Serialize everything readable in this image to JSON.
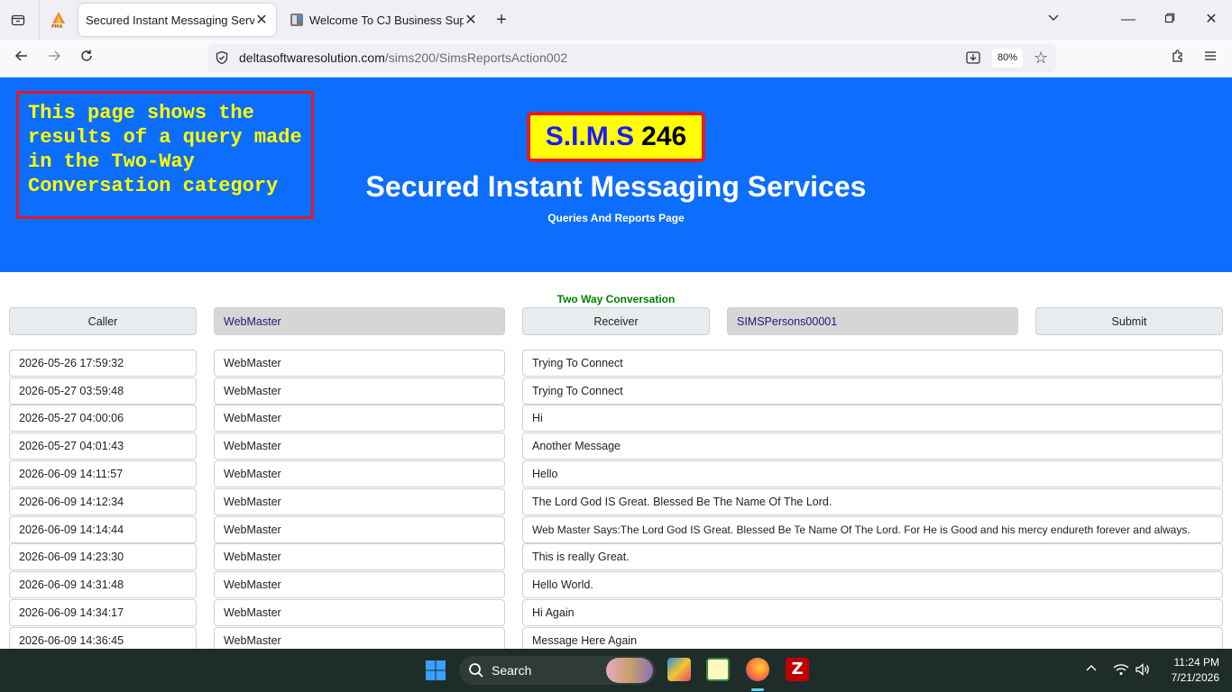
{
  "browser": {
    "tabs": [
      {
        "title": "Secured Instant Messaging Services",
        "active": true
      },
      {
        "title": "Welcome To CJ Business Suppo",
        "active": false
      }
    ],
    "url_host": "deltasoftwaresolution.com",
    "url_path": "/sims200/SimsReportsAction002",
    "zoom": "80%"
  },
  "banner": {
    "note": "This page shows the results of a query made in the Two-Way Conversation category",
    "logo_a": "S.I.M.S",
    "logo_b": "246",
    "title": "Secured Instant Messaging Services",
    "subtitle": "Queries And Reports Page"
  },
  "form": {
    "section_title": "Two Way Conversation",
    "caller_label": "Caller",
    "caller_value": "WebMaster",
    "receiver_label": "Receiver",
    "receiver_value": "SIMSPersons00001",
    "submit_label": "Submit"
  },
  "messages": [
    {
      "time": "2026-05-26 17:59:32",
      "sender": "WebMaster",
      "text": "Trying To Connect"
    },
    {
      "time": "2026-05-27 03:59:48",
      "sender": "WebMaster",
      "text": "Trying To Connect"
    },
    {
      "time": "2026-05-27 04:00:06",
      "sender": "WebMaster",
      "text": "Hi"
    },
    {
      "time": "2026-05-27 04:01:43",
      "sender": "WebMaster",
      "text": "Another Message"
    },
    {
      "time": "2026-06-09 14:11:57",
      "sender": "WebMaster",
      "text": "Hello"
    },
    {
      "time": "2026-06-09 14:12:34",
      "sender": "WebMaster",
      "text": "The Lord God IS Great. Blessed Be The Name Of The Lord."
    },
    {
      "time": "2026-06-09 14:14:44",
      "sender": "WebMaster",
      "text": "Web Master Says:The Lord God IS Great. Blessed Be Te Name Of The Lord. For He is Good and his mercy endureth forever and always."
    },
    {
      "time": "2026-06-09 14:23:30",
      "sender": "WebMaster",
      "text": "This is really Great."
    },
    {
      "time": "2026-06-09 14:31:48",
      "sender": "WebMaster",
      "text": "Hello World."
    },
    {
      "time": "2026-06-09 14:34:17",
      "sender": "WebMaster",
      "text": "Hi Again"
    },
    {
      "time": "2026-06-09 14:36:45",
      "sender": "WebMaster",
      "text": "Message Here Again"
    }
  ],
  "taskbar": {
    "search_label": "Search",
    "time": "11:24 PM",
    "date": "7/21/2026"
  }
}
